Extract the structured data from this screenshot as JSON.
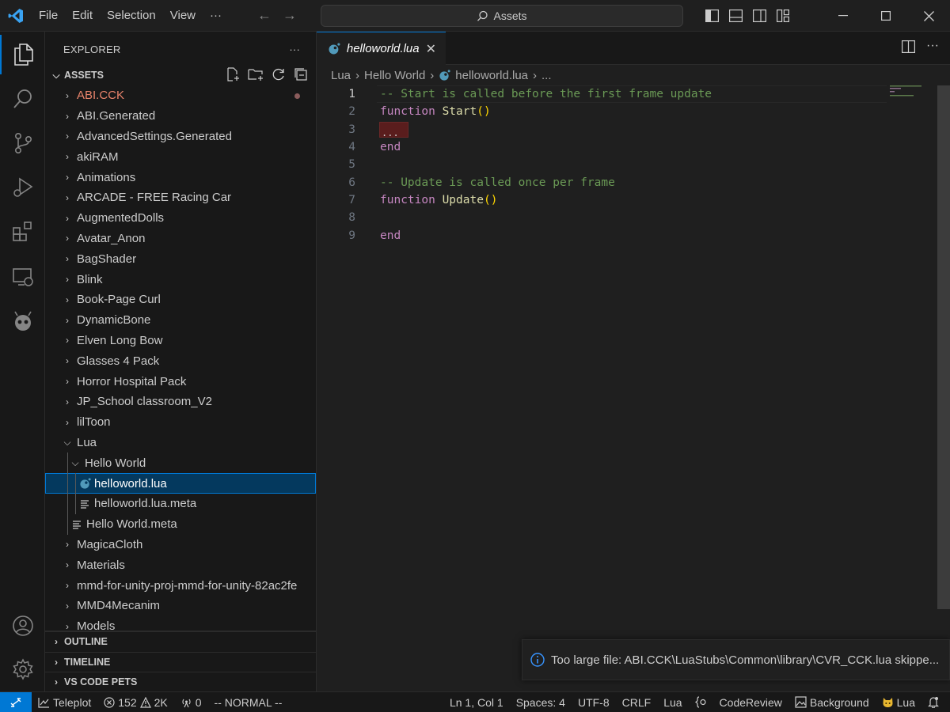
{
  "menu": [
    "File",
    "Edit",
    "Selection",
    "View",
    "···"
  ],
  "command_center": {
    "label": "Assets"
  },
  "explorer": {
    "title": "EXPLORER",
    "more": "···",
    "root": "ASSETS",
    "items": [
      {
        "label": "ABI.CCK",
        "type": "folder",
        "depth": 0,
        "expanded": false,
        "modified": true
      },
      {
        "label": "ABI.Generated",
        "type": "folder",
        "depth": 0,
        "expanded": false
      },
      {
        "label": "AdvancedSettings.Generated",
        "type": "folder",
        "depth": 0,
        "expanded": false
      },
      {
        "label": "akiRAM",
        "type": "folder",
        "depth": 0,
        "expanded": false
      },
      {
        "label": "Animations",
        "type": "folder",
        "depth": 0,
        "expanded": false
      },
      {
        "label": "ARCADE - FREE Racing Car",
        "type": "folder",
        "depth": 0,
        "expanded": false
      },
      {
        "label": "AugmentedDolls",
        "type": "folder",
        "depth": 0,
        "expanded": false
      },
      {
        "label": "Avatar_Anon",
        "type": "folder",
        "depth": 0,
        "expanded": false
      },
      {
        "label": "BagShader",
        "type": "folder",
        "depth": 0,
        "expanded": false
      },
      {
        "label": "Blink",
        "type": "folder",
        "depth": 0,
        "expanded": false
      },
      {
        "label": "Book-Page Curl",
        "type": "folder",
        "depth": 0,
        "expanded": false
      },
      {
        "label": "DynamicBone",
        "type": "folder",
        "depth": 0,
        "expanded": false
      },
      {
        "label": "Elven Long Bow",
        "type": "folder",
        "depth": 0,
        "expanded": false
      },
      {
        "label": "Glasses 4 Pack",
        "type": "folder",
        "depth": 0,
        "expanded": false
      },
      {
        "label": "Horror Hospital Pack",
        "type": "folder",
        "depth": 0,
        "expanded": false
      },
      {
        "label": "JP_School classroom_V2",
        "type": "folder",
        "depth": 0,
        "expanded": false
      },
      {
        "label": "lilToon",
        "type": "folder",
        "depth": 0,
        "expanded": false
      },
      {
        "label": "Lua",
        "type": "folder",
        "depth": 0,
        "expanded": true
      },
      {
        "label": "Hello World",
        "type": "folder",
        "depth": 1,
        "expanded": true
      },
      {
        "label": "helloworld.lua",
        "type": "lua",
        "depth": 2,
        "selected": true
      },
      {
        "label": "helloworld.lua.meta",
        "type": "meta",
        "depth": 2
      },
      {
        "label": "Hello World.meta",
        "type": "meta",
        "depth": 1
      },
      {
        "label": "MagicaCloth",
        "type": "folder",
        "depth": 0,
        "expanded": false
      },
      {
        "label": "Materials",
        "type": "folder",
        "depth": 0,
        "expanded": false
      },
      {
        "label": "mmd-for-unity-proj-mmd-for-unity-82ac2fe",
        "type": "folder",
        "depth": 0,
        "expanded": false
      },
      {
        "label": "MMD4Mecanim",
        "type": "folder",
        "depth": 0,
        "expanded": false
      },
      {
        "label": "Models",
        "type": "folder",
        "depth": 0,
        "expanded": false
      }
    ],
    "sections": [
      "OUTLINE",
      "TIMELINE",
      "VS CODE PETS"
    ]
  },
  "editor": {
    "tab_label": "helloworld.lua",
    "breadcrumb": [
      "Lua",
      "Hello World",
      "helloworld.lua",
      "..."
    ],
    "current_line": 1,
    "lines": [
      [
        {
          "t": "-- Start is called before the first frame update",
          "c": "cm"
        }
      ],
      [
        {
          "t": "function ",
          "c": "kw"
        },
        {
          "t": "Start",
          "c": "fn"
        },
        {
          "t": "()",
          "c": "pn"
        }
      ],
      [],
      [
        {
          "t": "end",
          "c": "kw"
        }
      ],
      [],
      [
        {
          "t": "-- Update is called once per frame",
          "c": "cm"
        }
      ],
      [
        {
          "t": "function ",
          "c": "kw"
        },
        {
          "t": "Update",
          "c": "fn"
        },
        {
          "t": "()",
          "c": "pn"
        }
      ],
      [],
      [
        {
          "t": "end",
          "c": "kw"
        }
      ]
    ],
    "ghost_text": "..."
  },
  "notification": {
    "text": "Too large file: ABI.CCK\\LuaStubs\\Common\\library\\CVR_CCK.lua skippe..."
  },
  "statusbar": {
    "teleplot": "Teleplot",
    "errors": "152",
    "warnings": "2K",
    "ports": "0",
    "mode": "-- NORMAL --",
    "position": "Ln 1, Col 1",
    "spaces": "Spaces: 4",
    "encoding": "UTF-8",
    "eol": "CRLF",
    "language": "Lua",
    "code_review": "CodeReview",
    "background": "Background",
    "lua_pet": "Lua"
  },
  "colors": {
    "accent": "#0078d4",
    "modified_folder": "#e8836b",
    "lua_icon": "#519aba"
  }
}
